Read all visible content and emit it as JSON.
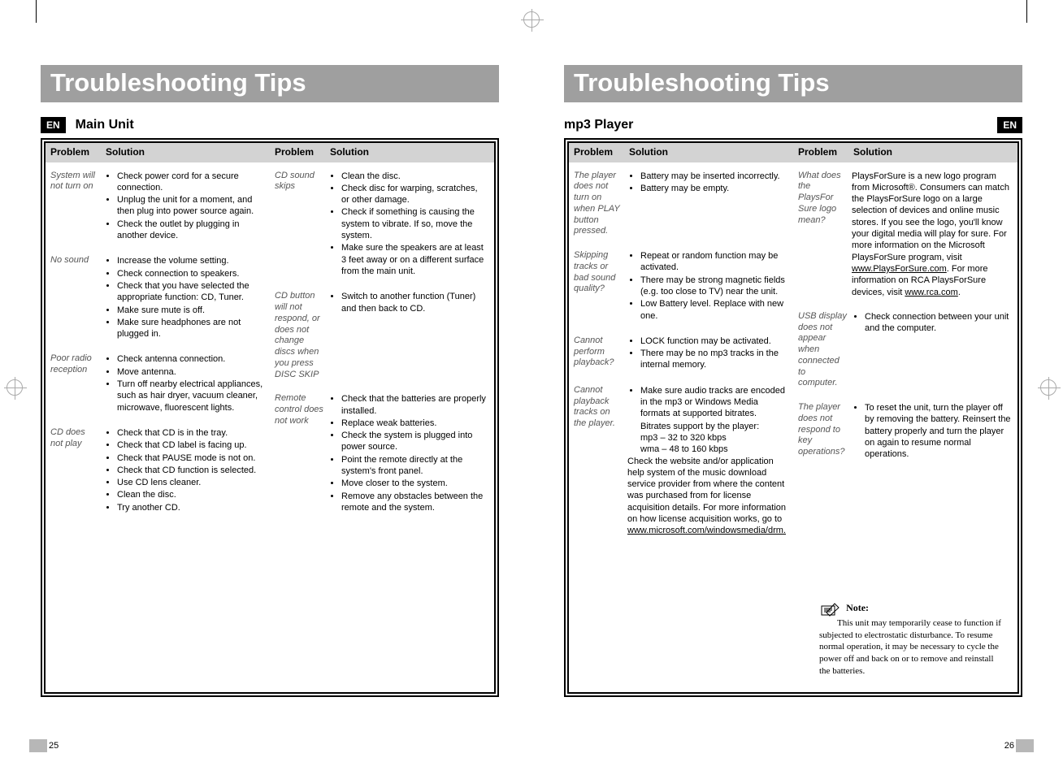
{
  "left": {
    "title": "Troubleshooting Tips",
    "lang": "EN",
    "subhead": "Main Unit",
    "headers": {
      "problem": "Problem",
      "solution": "Solution"
    },
    "colA": [
      {
        "problem": "System will not turn on",
        "bullets": [
          "Check power cord for a secure connection.",
          "Unplug the unit for a moment, and then plug into power source again.",
          "Check the outlet by plugging in another device."
        ]
      },
      {
        "problem": "No sound",
        "bullets": [
          "Increase the volume setting.",
          "Check connection to speakers.",
          "Check that you have selected the appropriate function: CD, Tuner.",
          "Make sure mute is off.",
          "Make sure headphones are not plugged in."
        ]
      },
      {
        "problem": "Poor radio reception",
        "bullets": [
          "Check antenna connection.",
          "Move antenna.",
          "Turn off nearby electrical appliances, such as hair dryer, vacuum cleaner, microwave, fluorescent lights."
        ]
      },
      {
        "problem": "CD does not play",
        "bullets": [
          "Check that CD is in the tray.",
          "Check that CD label is facing up.",
          "Check that PAUSE mode is not on.",
          "Check that CD function is selected.",
          "Use CD lens cleaner.",
          "Clean the disc.",
          "Try another CD."
        ]
      }
    ],
    "colB": [
      {
        "problem": "CD sound skips",
        "bullets": [
          "Clean the disc.",
          "Check disc for warping, scratches, or other damage.",
          "Check if something is causing the system to  vibrate. If so, move the  system.",
          "Make sure the speakers are at least 3 feet away or on a different surface from the main unit."
        ]
      },
      {
        "problem": "CD button will not respond, or does not change discs when you press DISC SKIP",
        "bullets": [
          "Switch to another function (Tuner) and then back to CD."
        ]
      },
      {
        "problem": "Remote control does not work",
        "bullets": [
          "Check that the batteries are properly installed.",
          "Replace weak batteries.",
          "Check the system is plugged into power source.",
          "Point the remote directly at the system's front panel.",
          "Move closer to the system.",
          "Remove any obstacles between the remote and the system."
        ]
      }
    ],
    "pageNumber": "25"
  },
  "right": {
    "title": "Troubleshooting Tips",
    "lang": "EN",
    "subhead": "mp3 Player",
    "headers": {
      "problem": "Problem",
      "solution": "Solution"
    },
    "colA": [
      {
        "problem": "The player does not turn on when PLAY button pressed.",
        "bullets": [
          "Battery may be inserted incorrectly.",
          "Battery may be empty."
        ]
      },
      {
        "problem": "Skipping tracks or bad sound quality?",
        "bullets": [
          "Repeat or random function may be activated.",
          "There may be strong magnetic fields (e.g. too close to TV) near the unit.",
          "Low Battery level. Replace with new one."
        ]
      },
      {
        "problem": "Cannot perform playback?",
        "bullets": [
          "LOCK function may be activated.",
          "There may be no mp3 tracks in the internal memory."
        ]
      },
      {
        "problem": "Cannot playback tracks on the player.",
        "bullets": [
          "Make sure audio tracks are encoded in the mp3 or Windows Media formats at supported bitrates."
        ],
        "extraLines": [
          "Bitrates support by the player:",
          "mp3 – 32 to 320 kbps",
          "wma – 48 to 160 kbps"
        ],
        "trailing": "Check the website and/or application help system of the music download service provider from where the content was purchased from for license acquisition details.\nFor more information on how license acquisition works, go to",
        "trailingLink": "www.microsoft.com/windowsmedia/drm."
      }
    ],
    "colB": [
      {
        "problem": "What does the PlaysFor Sure logo mean?",
        "text": "PlaysForSure is a new logo program from Microsoft®. Consumers can match the PlaysForSure logo on a large selection of devices and online music stores. If you see the logo, you'll know your digital media will play for sure.\nFor more information on the Microsoft PlaysForSure program, visit ",
        "link1": "www.PlaysForSure.com",
        "text2": ".\nFor more information on RCA PlaysForSure devices, visit ",
        "link2": "www.rca.com",
        "text3": "."
      },
      {
        "problem": "USB display does not appear when connected to computer.",
        "bullets": [
          "Check connection between your unit and the computer."
        ]
      },
      {
        "problem": "The player does not respond to key operations?",
        "bullets": [
          "To reset the unit, turn the player off by removing the battery. Reinsert the battery properly and turn the player on again to resume normal operations."
        ]
      }
    ],
    "note": {
      "title": "Note:",
      "body": "This unit may temporarily cease to function if subjected to electrostatic disturbance. To resume normal operation, it may be necessary to cycle the power off and back on or to remove and reinstall the batteries."
    },
    "pageNumber": "26"
  }
}
